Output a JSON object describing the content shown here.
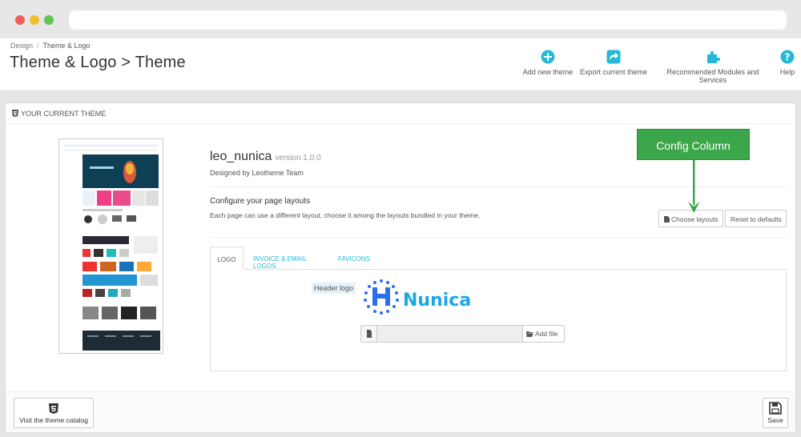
{
  "breadcrumb": {
    "parent": "Design",
    "current": "Theme & Logo"
  },
  "page_title": "Theme & Logo > Theme",
  "toolbar": {
    "add_new_theme": "Add new theme",
    "export_current_theme": "Export current theme",
    "recommended": "Recommended Modules and Services",
    "help": "Help"
  },
  "panel": {
    "heading": "YOUR CURRENT THEME",
    "theme_name": "leo_nunica",
    "version": "version 1.0.0",
    "designed_by": "Designed by Leotheme Team",
    "configure_title": "Configure your page layouts",
    "configure_desc": "Each page can use a different layout, choose it among the layouts bundled in your theme.",
    "choose_layouts": "Choose layouts",
    "reset_defaults": "Reset to defaults"
  },
  "tabs": {
    "logo": "LOGO",
    "invoice": "INVOICE & EMAIL LOGOS",
    "favicons": "FAVICONS"
  },
  "logo_pane": {
    "header_logo_label": "Header logo",
    "logo_wordmark": "Nunica",
    "add_file": "Add file"
  },
  "footer": {
    "visit_catalog": "Visit the theme catalog",
    "save": "Save"
  },
  "annotation": {
    "label": "Config Column"
  },
  "colors": {
    "accent": "#25b9d7",
    "callout_green": "#3ca64a",
    "logo_blue": "#1aa7e8"
  },
  "icons": [
    "plus-circle-icon",
    "export-icon",
    "puzzle-icon",
    "help-icon",
    "html5-icon",
    "file-icon",
    "folder-open-icon",
    "save-icon"
  ]
}
